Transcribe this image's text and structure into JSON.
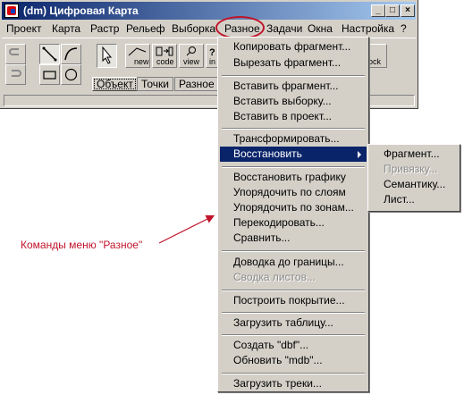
{
  "window": {
    "title": "(dm) Цифровая Карта",
    "buttons": {
      "minimize": "_",
      "maximize": "□",
      "close": "×"
    }
  },
  "menubar": [
    "Проект",
    "Карта",
    "Растр",
    "Рельеф",
    "Выборка",
    "Разное",
    "Задачи",
    "Окна",
    "Настройка",
    "?"
  ],
  "active_menu": "Разное",
  "toolbar": {
    "labels": [
      "new",
      "code",
      "view",
      "in",
      "ock"
    ],
    "tabs": [
      "Объект",
      "Точки",
      "Разное"
    ]
  },
  "dropdown": {
    "groups": [
      [
        "Копировать фрагмент...",
        "Вырезать фрагмент..."
      ],
      [
        "Вставить фрагмент...",
        "Вставить выборку...",
        "Вставить в проект..."
      ],
      [
        "Трансформировать...",
        "Восстановить"
      ],
      [
        "Восстановить графику",
        "Упорядочить по слоям",
        "Упорядочить по зонам...",
        "Перекодировать...",
        "Сравнить..."
      ],
      [
        "Доводка до границы...",
        "Сводка листов..."
      ],
      [
        "Построить покрытие..."
      ],
      [
        "Загрузить таблицу..."
      ],
      [
        "Создать \"dbf\"...",
        "Обновить \"mdb\"..."
      ],
      [
        "Загрузить треки..."
      ]
    ],
    "highlighted": "Восстановить",
    "disabled": [
      "Сводка листов..."
    ]
  },
  "submenu": {
    "items": [
      "Фрагмент...",
      "Привязку...",
      "Семантику...",
      "Лист..."
    ],
    "disabled": [
      "Привязку..."
    ]
  },
  "annotation": "Команды меню \"Разное\"",
  "colors": {
    "highlight": "#0a246a",
    "annotation": "#c0142a",
    "face": "#d4d0c8"
  }
}
